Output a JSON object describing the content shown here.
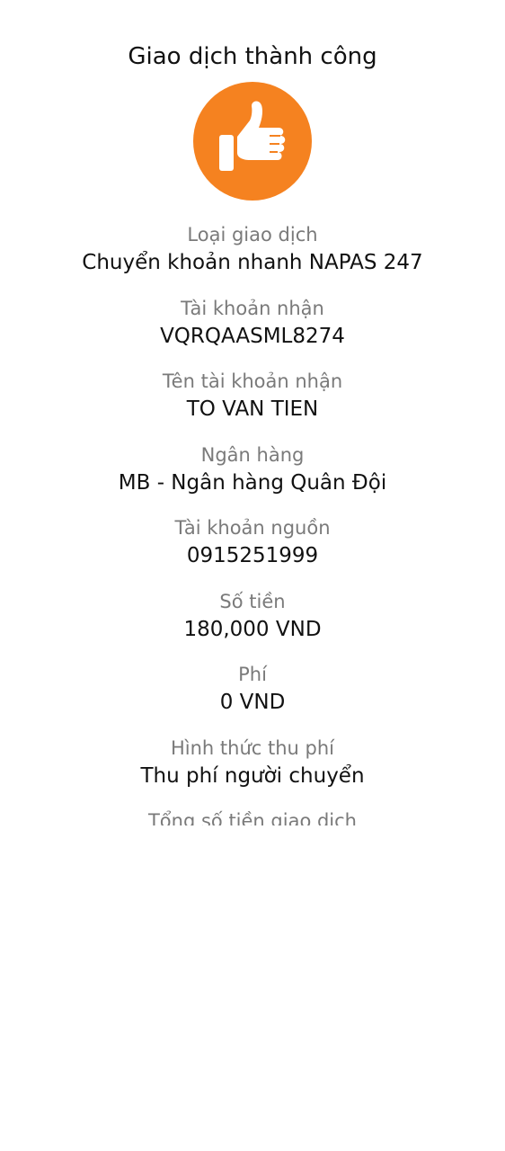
{
  "header": {
    "title": "Giao dịch thành công"
  },
  "icon": {
    "name": "thumbs-up-icon",
    "color": "#F58220"
  },
  "details": [
    {
      "label": "Loại giao dịch",
      "value": "Chuyển khoản nhanh NAPAS 247"
    },
    {
      "label": "Tài khoản nhận",
      "value": "VQRQAASML8274"
    },
    {
      "label": "Tên tài khoản nhận",
      "value": "TO VAN TIEN"
    },
    {
      "label": "Ngân hàng",
      "value": "MB - Ngân hàng Quân Đội"
    },
    {
      "label": "Tài khoản nguồn",
      "value": "0915251999"
    },
    {
      "label": "Số tiền",
      "value": "180,000 VND"
    },
    {
      "label": "Phí",
      "value": "0 VND"
    },
    {
      "label": "Hình thức thu phí",
      "value": "Thu phí người chuyển"
    },
    {
      "label": "Tổng số tiền giao dịch",
      "value": ""
    }
  ]
}
